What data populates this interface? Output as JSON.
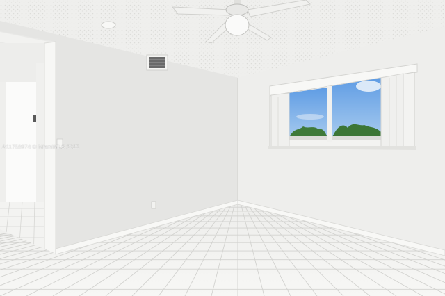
{
  "photo": {
    "subject": "empty room",
    "watermark": "A11758974 © MiamiMLS 2025"
  },
  "colors": {
    "wall_left": "#e6e6e4",
    "wall_right": "#eeeeec",
    "ceiling": "#efefed",
    "floor_tile": "#f4f4f2",
    "grout": "#d2d2cf",
    "sky": "#7aaee6",
    "trim": "#f7f7f5"
  },
  "icons": [
    "ceiling-fan-icon",
    "air-vent-icon",
    "window-icon",
    "doorway-icon",
    "light-switch-icon",
    "outlet-icon"
  ]
}
